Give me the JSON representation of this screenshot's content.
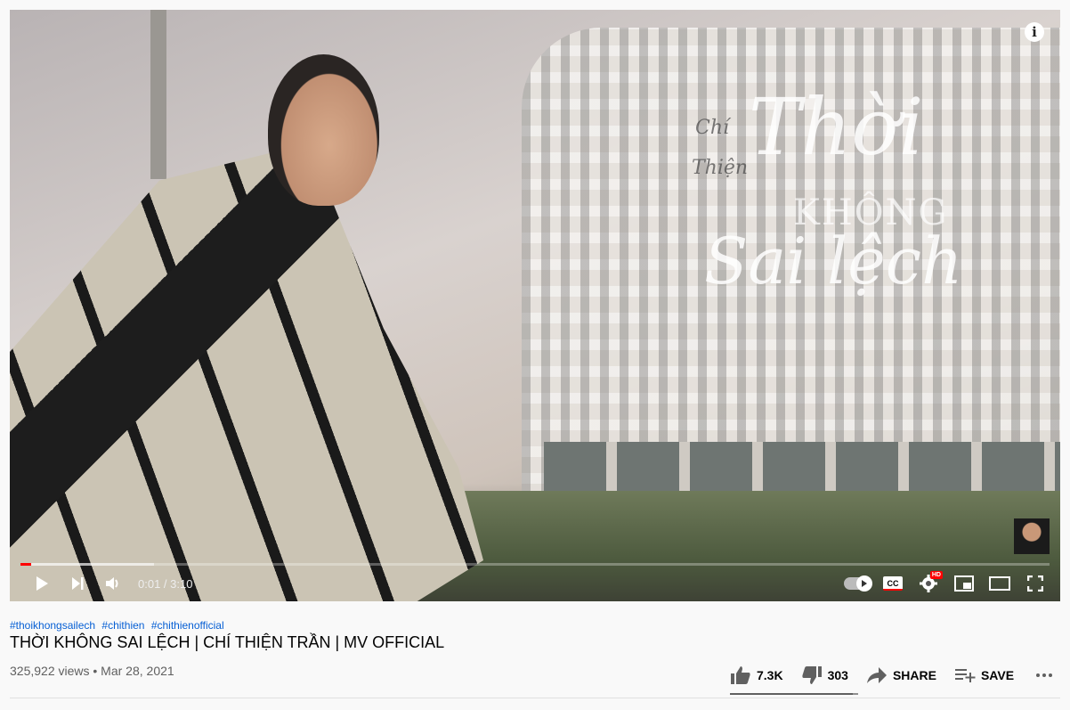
{
  "video": {
    "title_art": {
      "chi": "Chí",
      "thien": "Thiện",
      "thoi": "Thời",
      "khong": "KHÔNG",
      "sai_lech": "Sai lệch"
    },
    "time_current": "0:01 / 3:10",
    "progress_played": 0.01,
    "progress_loaded": 0.13,
    "icons": {
      "info": "info-icon",
      "play": "play-icon",
      "next": "next-icon",
      "volume": "volume-icon",
      "autoplay": "autoplay-toggle-icon",
      "subtitles": "subtitles-icon",
      "settings": "settings-icon",
      "miniplayer": "miniplayer-icon",
      "theater": "theater-icon",
      "fullscreen": "fullscreen-icon"
    },
    "info_glyph": "i",
    "cc_label": "CC",
    "hd_label": "HD"
  },
  "meta": {
    "hashtags": [
      "#thoikhongsailech",
      "#chithien",
      "#chithienofficial"
    ],
    "title": "THỜI KHÔNG SAI LỆCH | CHÍ THIỆN TRẦN | MV OFFICIAL",
    "views_date": "325,922 views • Mar 28, 2021"
  },
  "actions": {
    "likes": "7.3K",
    "dislikes": "303",
    "share": "SHARE",
    "save": "SAVE",
    "like_ratio": 0.96
  },
  "colors": {
    "accent": "#ff0000",
    "link": "#065fd4"
  }
}
